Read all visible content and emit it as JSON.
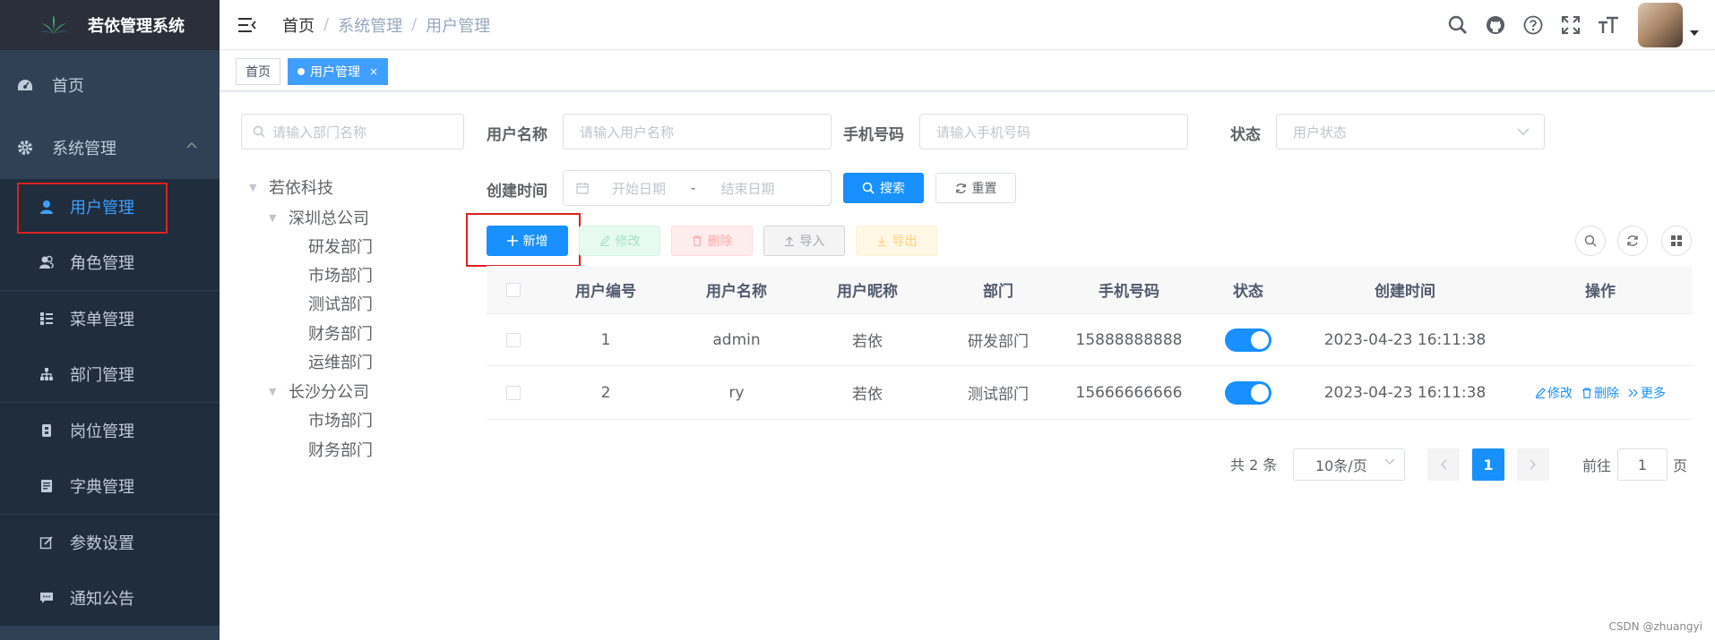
{
  "app": {
    "title": "若依管理系统"
  },
  "sidebar": {
    "items": [
      {
        "label": "首页",
        "icon": "dashboard-icon"
      },
      {
        "label": "系统管理",
        "icon": "gear-icon"
      },
      {
        "label": "用户管理",
        "icon": "user-icon"
      },
      {
        "label": "角色管理",
        "icon": "peoples-icon"
      },
      {
        "label": "菜单管理",
        "icon": "tree-table-icon"
      },
      {
        "label": "部门管理",
        "icon": "tree-icon"
      },
      {
        "label": "岗位管理",
        "icon": "post-icon"
      },
      {
        "label": "字典管理",
        "icon": "dict-icon"
      },
      {
        "label": "参数设置",
        "icon": "edit-icon"
      },
      {
        "label": "通知公告",
        "icon": "message-icon"
      }
    ],
    "active": "用户管理"
  },
  "breadcrumb": [
    "首页",
    "系统管理",
    "用户管理"
  ],
  "tags": [
    {
      "label": "首页"
    },
    {
      "label": "用户管理",
      "close": "×"
    }
  ],
  "dept": {
    "placeholder": "请输入部门名称",
    "tree": {
      "root": "若依科技",
      "shenzhen": "深圳总公司",
      "sz_children": [
        "研发部门",
        "市场部门",
        "测试部门",
        "财务部门",
        "运维部门"
      ],
      "changsha": "长沙分公司",
      "cs_children": [
        "市场部门",
        "财务部门"
      ]
    }
  },
  "search": {
    "username_label": "用户名称",
    "username_placeholder": "请输入用户名称",
    "phone_label": "手机号码",
    "phone_placeholder": "请输入手机号码",
    "status_label": "状态",
    "status_placeholder": "用户状态",
    "created_label": "创建时间",
    "start_placeholder": "开始日期",
    "range_sep": "-",
    "end_placeholder": "结束日期",
    "search_btn": "搜索",
    "reset_btn": "重置"
  },
  "toolbar": {
    "add": "新增",
    "edit": "修改",
    "delete": "删除",
    "import": "导入",
    "export": "导出"
  },
  "table": {
    "columns": [
      "用户编号",
      "用户名称",
      "用户昵称",
      "部门",
      "手机号码",
      "状态",
      "创建时间",
      "操作"
    ],
    "rows": [
      {
        "id": "1",
        "username": "admin",
        "nickname": "若依",
        "dept": "研发部门",
        "phone": "15888888888",
        "status": true,
        "created": "2023-04-23 16:11:38"
      },
      {
        "id": "2",
        "username": "ry",
        "nickname": "若依",
        "dept": "测试部门",
        "phone": "15666666666",
        "status": true,
        "created": "2023-04-23 16:11:38",
        "ops": [
          "修改",
          "删除",
          "更多"
        ]
      }
    ]
  },
  "pagination": {
    "total": "共 2 条",
    "page_size": "10条/页",
    "current": "1",
    "goto_label": "前往",
    "goto_value": "1",
    "page_suffix": "页"
  },
  "watermark": "CSDN @zhuangyi",
  "colors": {
    "sidebar_bg": "#304156",
    "primary": "#1890ff",
    "highlight_box": "#e02020"
  }
}
